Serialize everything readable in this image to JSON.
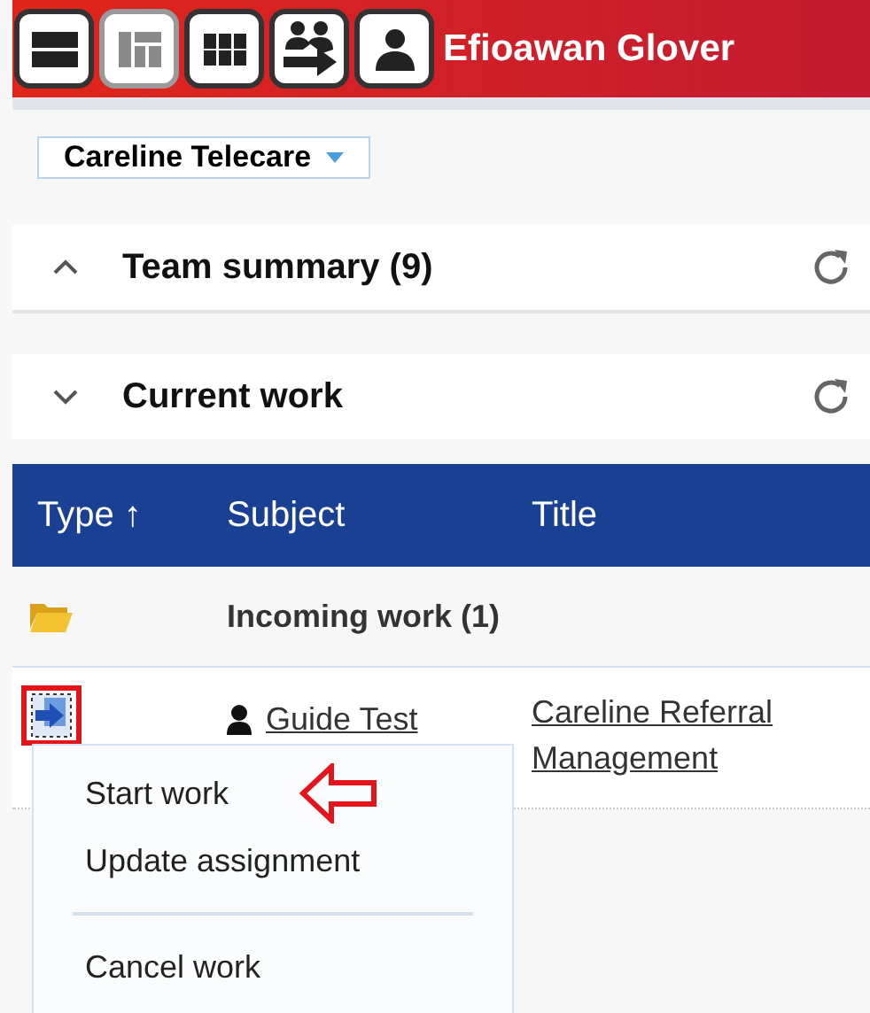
{
  "header": {
    "view_buttons": [
      {
        "kind": "rows",
        "selected": false
      },
      {
        "kind": "dashboard",
        "selected": true
      },
      {
        "kind": "grid",
        "selected": false
      },
      {
        "kind": "transfer",
        "selected": false
      },
      {
        "kind": "person",
        "selected": false
      }
    ],
    "user_name": "Efioawan Glover"
  },
  "team_selector": {
    "value": "Careline Telecare"
  },
  "sections": [
    {
      "title": "Team summary (9)",
      "expanded": false
    },
    {
      "title": "Current work",
      "expanded": true
    }
  ],
  "table": {
    "columns": [
      {
        "label": "Type",
        "sort": "↑"
      },
      {
        "label": "Subject"
      },
      {
        "label": "Title"
      }
    ],
    "group": {
      "label": "Incoming work (1)"
    },
    "rows": [
      {
        "subject": "Guide Test",
        "title": "Careline Referral Management",
        "highlighted": true
      }
    ]
  },
  "context_menu": {
    "items": [
      {
        "label": "Start work",
        "pointed": true
      },
      {
        "label": "Update assignment",
        "pointed": false
      },
      {
        "kind": "separator"
      },
      {
        "label": "Cancel work",
        "pointed": false
      }
    ]
  }
}
